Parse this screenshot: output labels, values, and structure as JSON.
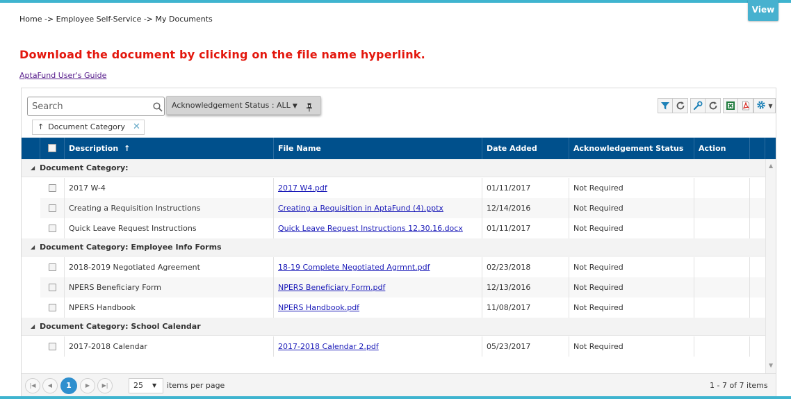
{
  "header": {
    "view_label": "View"
  },
  "breadcrumb": "Home -> Employee Self-Service -> My Documents",
  "headline": "Download the document by clicking on the file name hyperlink.",
  "guide_link": "AptaFund User's Guide",
  "toolbar": {
    "search_placeholder": "Search",
    "ack_filter_label": "Acknowledgement Status : ALL",
    "group_chip_label": "Document Category",
    "icons": [
      "filter-icon",
      "refresh-icon",
      "wrench-icon",
      "refresh-icon",
      "excel-icon",
      "pdf-icon",
      "gear-icon"
    ]
  },
  "grid": {
    "columns": [
      "Description",
      "File Name",
      "Date Added",
      "Acknowledgement Status",
      "Action"
    ],
    "groups": [
      {
        "label": "Document Category:",
        "rows": [
          {
            "description": "2017 W-4",
            "file": "2017 W4.pdf",
            "date": "01/11/2017",
            "status": "Not Required"
          },
          {
            "description": "Creating a Requisition Instructions",
            "file": "Creating a Requisition in AptaFund (4).pptx",
            "date": "12/14/2016",
            "status": "Not Required"
          },
          {
            "description": "Quick Leave Request Instructions",
            "file": "Quick Leave Request Instructions 12.30.16.docx",
            "date": "01/11/2017",
            "status": "Not Required"
          }
        ]
      },
      {
        "label": "Document Category: Employee Info Forms",
        "rows": [
          {
            "description": "2018-2019 Negotiated Agreement",
            "file": "18-19 Complete Negotiated Agrmnt.pdf",
            "date": "02/23/2018",
            "status": "Not Required"
          },
          {
            "description": "NPERS Beneficiary Form",
            "file": "NPERS Beneficiary Form.pdf",
            "date": "12/13/2016",
            "status": "Not Required"
          },
          {
            "description": "NPERS Handbook",
            "file": "NPERS Handbook.pdf",
            "date": "11/08/2017",
            "status": "Not Required"
          }
        ]
      },
      {
        "label": "Document Category: School Calendar",
        "rows": [
          {
            "description": "2017-2018 Calendar",
            "file": "2017-2018 Calendar 2.pdf",
            "date": "05/23/2017",
            "status": "Not Required"
          }
        ]
      }
    ]
  },
  "pager": {
    "current_page": "1",
    "page_size": "25",
    "page_size_label": "items per page",
    "info": "1 - 7 of 7 items"
  }
}
